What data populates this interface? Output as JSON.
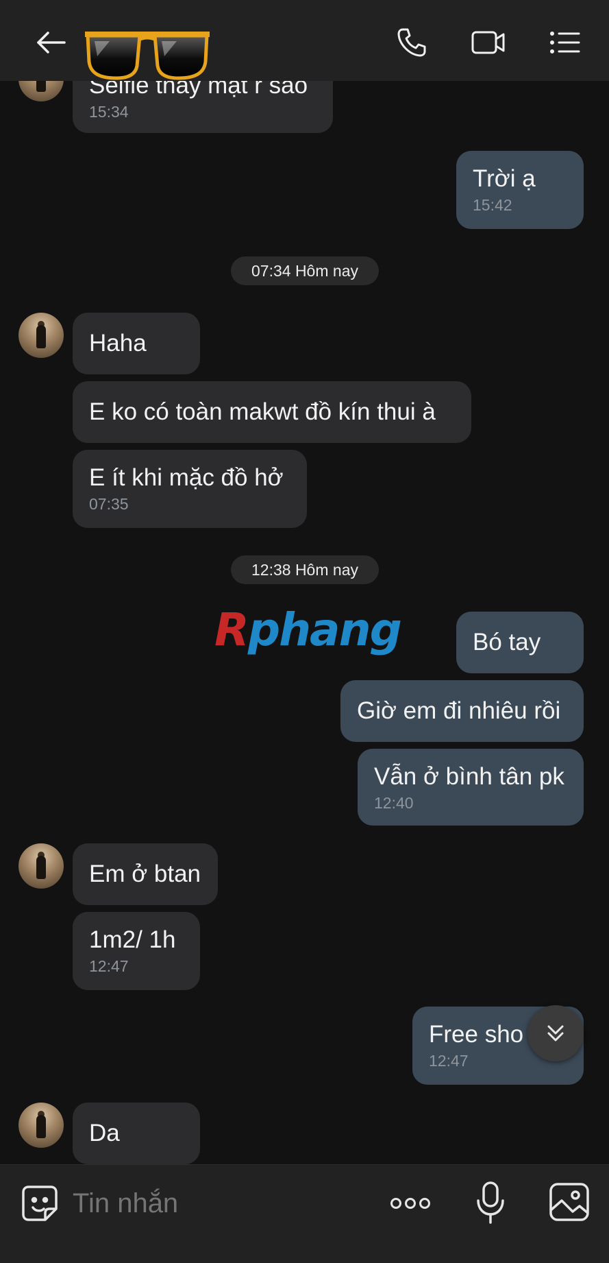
{
  "header": {
    "back_icon": "arrow-left-icon",
    "contact_avatar": "sunglasses-icon",
    "call_icon": "phone-icon",
    "video_icon": "video-camera-icon",
    "menu_icon": "list-menu-icon"
  },
  "messages": [
    {
      "side": "in",
      "text": "Selfie thấy mặt r sao",
      "time": "15:34"
    },
    {
      "side": "out",
      "text": "Trời ạ",
      "time": "15:42"
    },
    {
      "type": "day",
      "text": "07:34 Hôm nay"
    },
    {
      "side": "in",
      "text": "Haha"
    },
    {
      "side": "in",
      "text": "E ko có toàn makwt đồ kín thui à"
    },
    {
      "side": "in",
      "text": "E ít khi mặc đồ hở",
      "time": "07:35"
    },
    {
      "type": "day",
      "text": "12:38 Hôm nay"
    },
    {
      "side": "out",
      "text": "Bó tay"
    },
    {
      "side": "out",
      "text": "Giờ em đi nhiêu rồi"
    },
    {
      "side": "out",
      "text": "Vẫn ở bình tân pk",
      "time": "12:40"
    },
    {
      "side": "in",
      "text": "Em ở btan"
    },
    {
      "side": "in",
      "text": "1m2/ 1h",
      "time": "12:47"
    },
    {
      "side": "out",
      "text": "Free sho",
      "time": "12:47"
    },
    {
      "side": "in",
      "text": "Da"
    }
  ],
  "watermark": {
    "first": "R",
    "rest": "phang"
  },
  "composer": {
    "placeholder": "Tin nhắn",
    "emoji_icon": "sticker-icon",
    "more_icon": "more-dots-icon",
    "mic_icon": "microphone-icon",
    "image_icon": "image-icon"
  },
  "scroll_icon": "double-chevron-down-icon",
  "colors": {
    "background": "#121212",
    "bar": "#222222",
    "incoming_bubble": "#2c2c2e",
    "outgoing_bubble": "#3c4a58",
    "time_text": "#8e959c"
  }
}
